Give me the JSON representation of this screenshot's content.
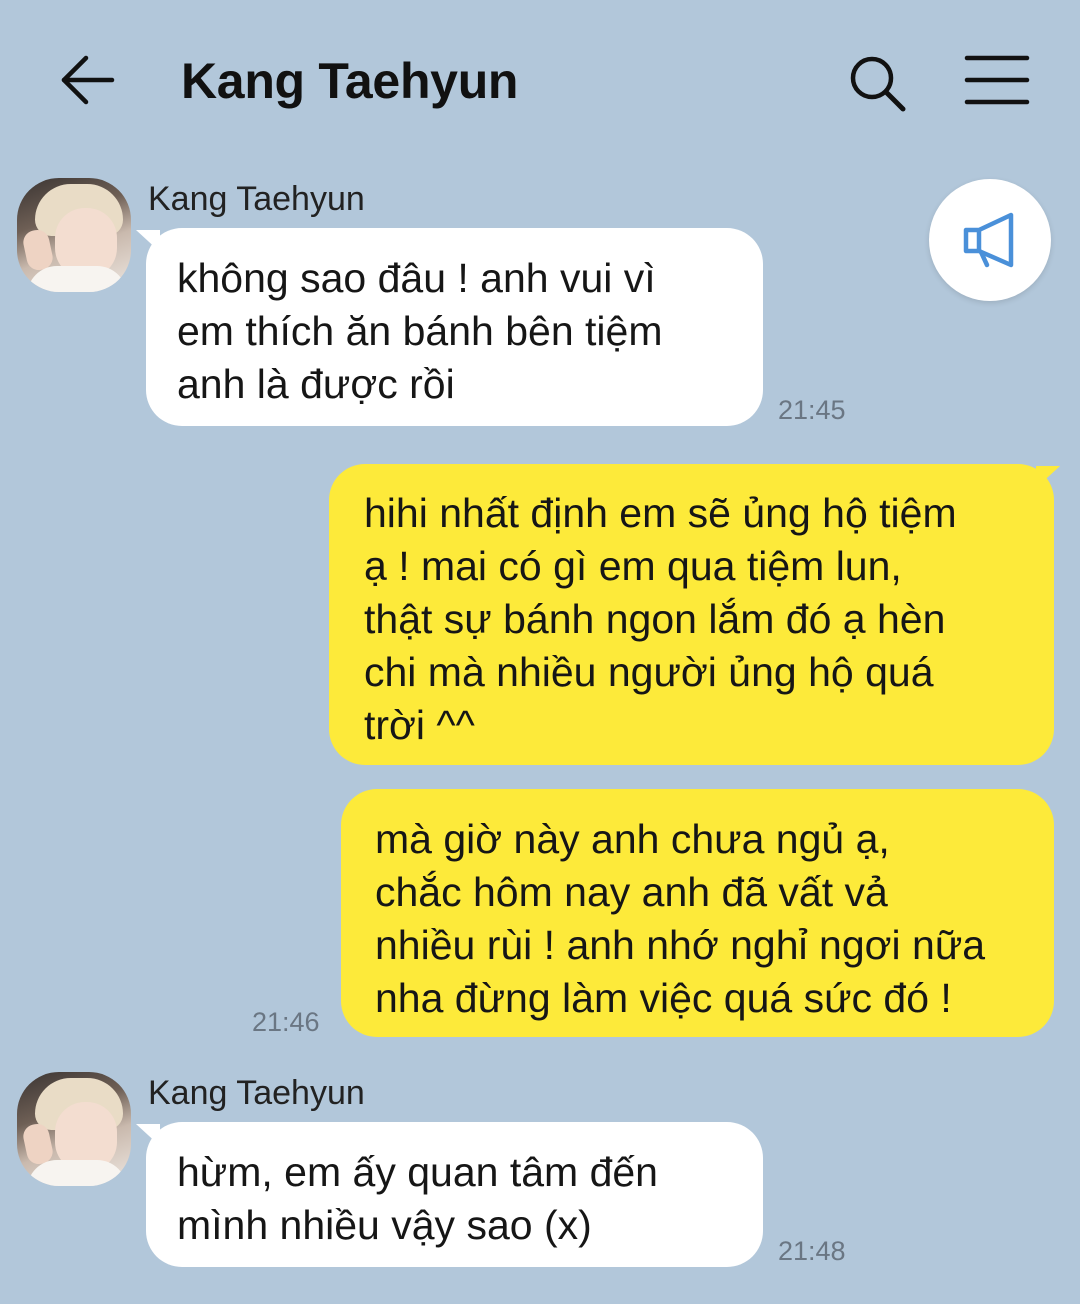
{
  "header": {
    "title": "Kang Taehyun",
    "back_icon": "arrow-left-icon",
    "search_icon": "search-icon",
    "menu_icon": "hamburger-menu-icon"
  },
  "announcement_icon": "megaphone-icon",
  "colors": {
    "background": "#b2c7da",
    "incoming_bubble": "#ffffff",
    "outgoing_bubble": "#fdea3a",
    "timestamp": "#6a7683",
    "icon_blue": "#4a90d9"
  },
  "messages": [
    {
      "direction": "incoming",
      "sender": "Kang Taehyun",
      "lines": [
        "không sao đâu ! anh vui vì",
        "em thích ăn bánh bên tiệm",
        "anh là được rồi"
      ],
      "time": "21:45"
    },
    {
      "direction": "outgoing",
      "lines": [
        "hihi nhất định em sẽ ủng hộ tiệm",
        "ạ ! mai có gì em qua tiệm lun,",
        "thật sự bánh ngon lắm đó ạ hèn",
        "chi mà nhiều người ủng hộ quá",
        "trời ^^"
      ],
      "time": ""
    },
    {
      "direction": "outgoing",
      "lines": [
        "mà giờ này anh chưa ngủ ạ,",
        "chắc hôm nay anh đã vất vả",
        "nhiều rùi ! anh nhớ nghỉ ngơi nữa",
        "nha đừng làm việc quá sức đó !"
      ],
      "time": "21:46"
    },
    {
      "direction": "incoming",
      "sender": "Kang Taehyun",
      "lines": [
        "hừm, em ấy quan tâm đến",
        "mình nhiều vậy sao (x)"
      ],
      "time": "21:48"
    }
  ]
}
